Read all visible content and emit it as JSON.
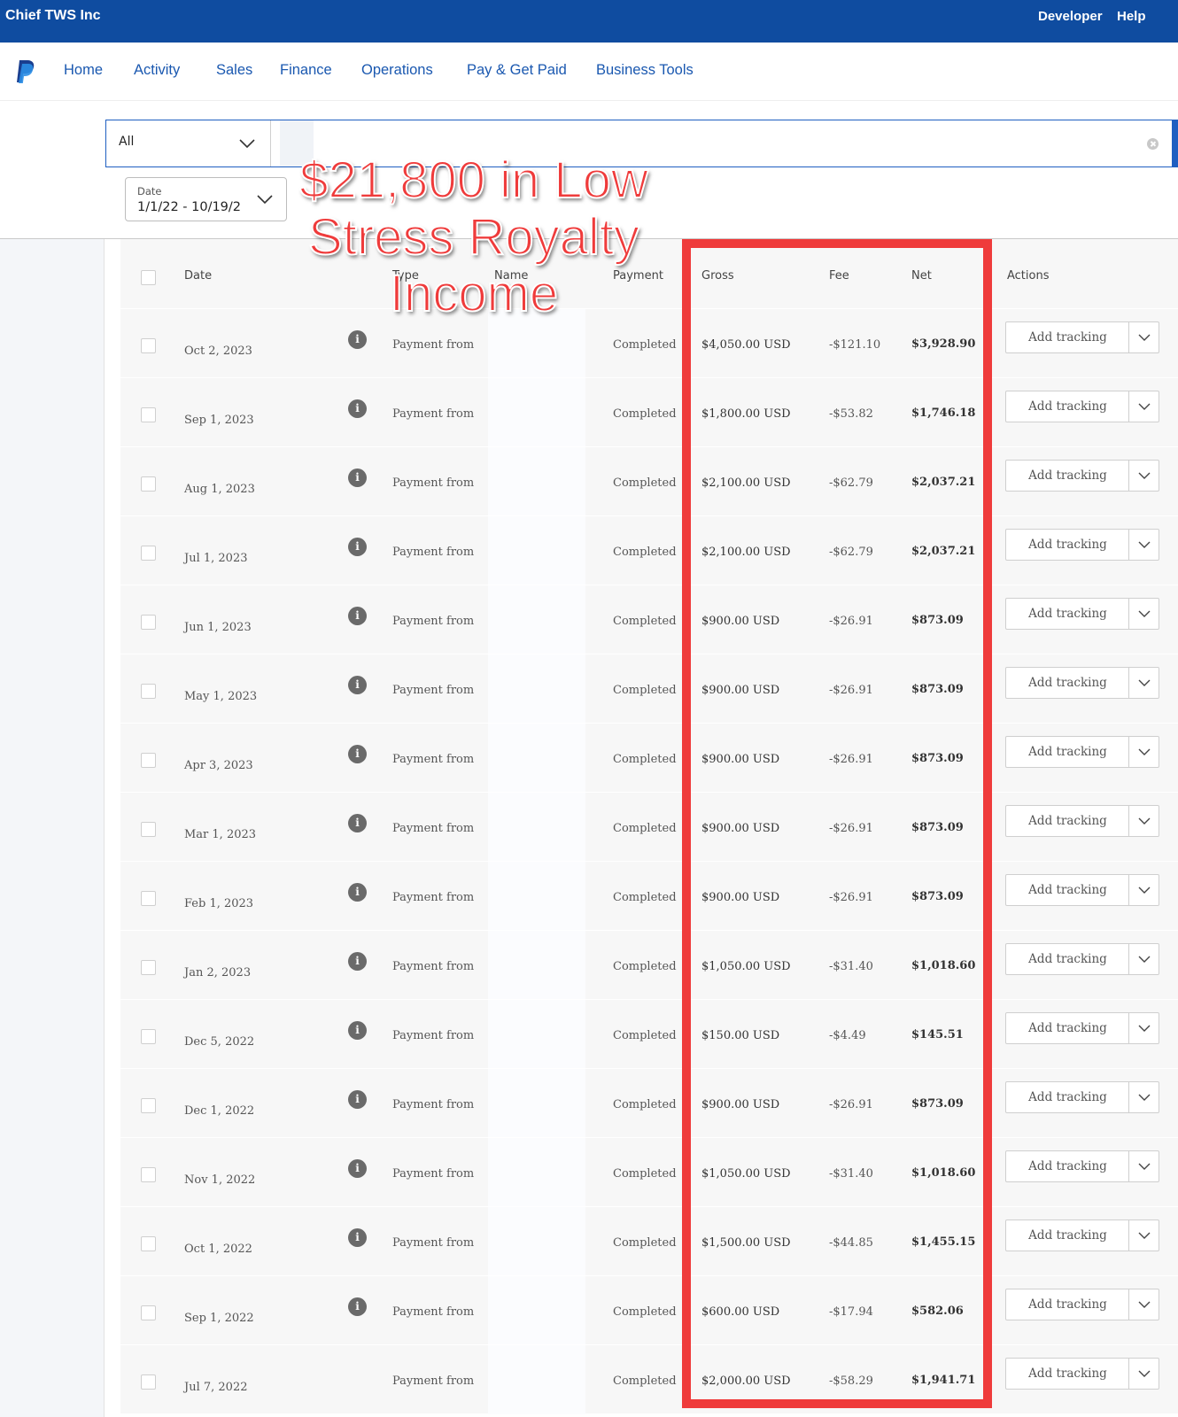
{
  "topbar": {
    "brand": "Chief TWS Inc",
    "developer": "Developer",
    "help": "Help"
  },
  "nav": {
    "items": [
      "Home",
      "Activity",
      "Sales",
      "Finance",
      "Operations",
      "Pay & Get Paid",
      "Business Tools"
    ]
  },
  "filters": {
    "type_value": "All",
    "search_placeholder": "",
    "date_label": "Date",
    "date_value": "1/1/22 - 10/19/2"
  },
  "table": {
    "headers": {
      "date": "Date",
      "type": "Type",
      "name": "Name",
      "payment": "Payment",
      "gross": "Gross",
      "fee": "Fee",
      "net": "Net",
      "actions": "Actions"
    },
    "action_label": "Add tracking",
    "rows": [
      {
        "date": "Oct 2, 2023",
        "type": "Payment from",
        "status": "Completed",
        "gross": "$4,050.00 USD",
        "fee": "-$121.10",
        "net": "$3,928.90"
      },
      {
        "date": "Sep 1, 2023",
        "type": "Payment from",
        "status": "Completed",
        "gross": "$1,800.00 USD",
        "fee": "-$53.82",
        "net": "$1,746.18"
      },
      {
        "date": "Aug 1, 2023",
        "type": "Payment from",
        "status": "Completed",
        "gross": "$2,100.00 USD",
        "fee": "-$62.79",
        "net": "$2,037.21"
      },
      {
        "date": "Jul 1, 2023",
        "type": "Payment from",
        "status": "Completed",
        "gross": "$2,100.00 USD",
        "fee": "-$62.79",
        "net": "$2,037.21"
      },
      {
        "date": "Jun 1, 2023",
        "type": "Payment from",
        "status": "Completed",
        "gross": "$900.00 USD",
        "fee": "-$26.91",
        "net": "$873.09"
      },
      {
        "date": "May 1, 2023",
        "type": "Payment from",
        "status": "Completed",
        "gross": "$900.00 USD",
        "fee": "-$26.91",
        "net": "$873.09"
      },
      {
        "date": "Apr 3, 2023",
        "type": "Payment from",
        "status": "Completed",
        "gross": "$900.00 USD",
        "fee": "-$26.91",
        "net": "$873.09"
      },
      {
        "date": "Mar 1, 2023",
        "type": "Payment from",
        "status": "Completed",
        "gross": "$900.00 USD",
        "fee": "-$26.91",
        "net": "$873.09"
      },
      {
        "date": "Feb 1, 2023",
        "type": "Payment from",
        "status": "Completed",
        "gross": "$900.00 USD",
        "fee": "-$26.91",
        "net": "$873.09"
      },
      {
        "date": "Jan 2, 2023",
        "type": "Payment from",
        "status": "Completed",
        "gross": "$1,050.00 USD",
        "fee": "-$31.40",
        "net": "$1,018.60"
      },
      {
        "date": "Dec 5, 2022",
        "type": "Payment from",
        "status": "Completed",
        "gross": "$150.00 USD",
        "fee": "-$4.49",
        "net": "$145.51"
      },
      {
        "date": "Dec 1, 2022",
        "type": "Payment from",
        "status": "Completed",
        "gross": "$900.00 USD",
        "fee": "-$26.91",
        "net": "$873.09"
      },
      {
        "date": "Nov 1, 2022",
        "type": "Payment from",
        "status": "Completed",
        "gross": "$1,050.00 USD",
        "fee": "-$31.40",
        "net": "$1,018.60"
      },
      {
        "date": "Oct 1, 2022",
        "type": "Payment from",
        "status": "Completed",
        "gross": "$1,500.00 USD",
        "fee": "-$44.85",
        "net": "$1,455.15"
      },
      {
        "date": "Sep 1, 2022",
        "type": "Payment from",
        "status": "Completed",
        "gross": "$600.00 USD",
        "fee": "-$17.94",
        "net": "$582.06"
      },
      {
        "date": "Jul 7, 2022",
        "type": "Payment from",
        "status": "Completed",
        "gross": "$2,000.00 USD",
        "fee": "-$58.29",
        "net": "$1,941.71"
      }
    ]
  },
  "overlay": {
    "lines": [
      "$21,800 in Low",
      "Stress Royalty",
      "Income"
    ]
  },
  "colors": {
    "topbar": "#0f4ca0",
    "nav_link": "#1a58b0",
    "highlight": "#ef3b3b"
  },
  "icons": {
    "logo": "paypal-logo",
    "info": "info-icon",
    "chevron": "chevron-down-icon",
    "clear": "clear-icon"
  }
}
